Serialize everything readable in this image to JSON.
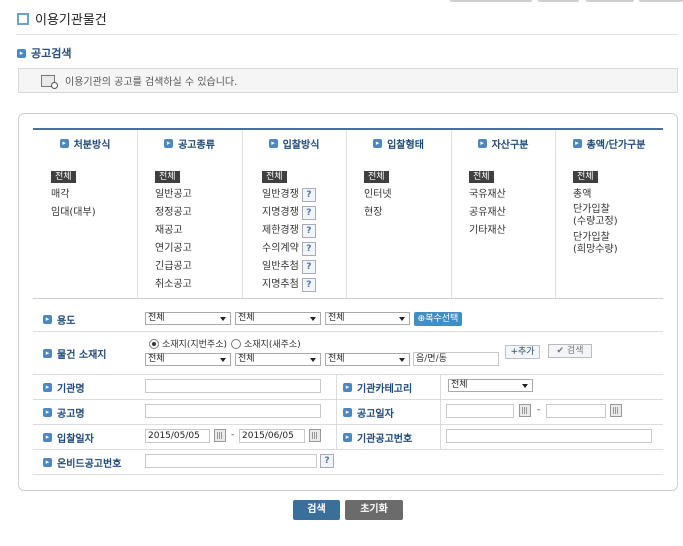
{
  "page_title": "이용기관물건",
  "section_title": "공고검색",
  "info_text": "이용기관의 공고를 검색하실 수 있습니다.",
  "columns": [
    {
      "header": "처분방식",
      "items": [
        {
          "label": "전체",
          "selected": true,
          "help": false
        },
        {
          "label": "매각",
          "selected": false,
          "help": false
        },
        {
          "label": "임대(대부)",
          "selected": false,
          "help": false
        }
      ]
    },
    {
      "header": "공고종류",
      "items": [
        {
          "label": "전체",
          "selected": true,
          "help": false
        },
        {
          "label": "일반공고",
          "selected": false,
          "help": false
        },
        {
          "label": "정정공고",
          "selected": false,
          "help": false
        },
        {
          "label": "재공고",
          "selected": false,
          "help": false
        },
        {
          "label": "연기공고",
          "selected": false,
          "help": false
        },
        {
          "label": "긴급공고",
          "selected": false,
          "help": false
        },
        {
          "label": "취소공고",
          "selected": false,
          "help": false
        }
      ]
    },
    {
      "header": "입찰방식",
      "items": [
        {
          "label": "전체",
          "selected": true,
          "help": false
        },
        {
          "label": "일반경쟁",
          "selected": false,
          "help": true
        },
        {
          "label": "지명경쟁",
          "selected": false,
          "help": true
        },
        {
          "label": "제한경쟁",
          "selected": false,
          "help": true
        },
        {
          "label": "수의계약",
          "selected": false,
          "help": true
        },
        {
          "label": "일반추첨",
          "selected": false,
          "help": true
        },
        {
          "label": "지명추첨",
          "selected": false,
          "help": true
        }
      ]
    },
    {
      "header": "입찰형태",
      "items": [
        {
          "label": "전체",
          "selected": true,
          "help": false
        },
        {
          "label": "인터넷",
          "selected": false,
          "help": false
        },
        {
          "label": "현장",
          "selected": false,
          "help": false
        }
      ]
    },
    {
      "header": "자산구분",
      "items": [
        {
          "label": "전체",
          "selected": true,
          "help": false
        },
        {
          "label": "국유재산",
          "selected": false,
          "help": false
        },
        {
          "label": "공유재산",
          "selected": false,
          "help": false
        },
        {
          "label": "기타재산",
          "selected": false,
          "help": false
        }
      ]
    },
    {
      "header": "총액/단가구분",
      "items": [
        {
          "label": "전체",
          "selected": true,
          "help": false
        },
        {
          "label": "총액",
          "selected": false,
          "help": false
        },
        {
          "label": "단가입찰\n(수량고정)",
          "selected": false,
          "help": false
        },
        {
          "label": "단가입찰\n(희망수량)",
          "selected": false,
          "help": false
        }
      ]
    }
  ],
  "help_mark": "?",
  "usage": {
    "label": "용도",
    "selects": [
      "전체",
      "전체",
      "전체"
    ],
    "multi_button": "복수선택"
  },
  "location": {
    "label": "물건 소재지",
    "radio1": "소재지(지번주소)",
    "radio2": "소재지(새주소)",
    "selects": [
      "전체",
      "전체",
      "전체"
    ],
    "dong_placeholder": "읍/면/동",
    "add_button": "+추가",
    "search_button": "검색"
  },
  "org_name": {
    "label": "기관명",
    "value": ""
  },
  "org_category": {
    "label": "기관카테고리",
    "value": "전체"
  },
  "notice_name": {
    "label": "공고명",
    "value": ""
  },
  "notice_date": {
    "label": "공고일자",
    "from": "",
    "to": "",
    "separator": "-"
  },
  "bid_date": {
    "label": "입찰일자",
    "from": "2015/05/05",
    "to": "2015/06/05",
    "separator": "-"
  },
  "org_notice_no": {
    "label": "기관공고번호",
    "value": ""
  },
  "onbid_notice_no": {
    "label": "온비드공고번호",
    "value": ""
  },
  "buttons": {
    "search": "검색",
    "reset": "초기화"
  },
  "colors": {
    "accent": "#1f4a7a",
    "search_btn": "#3a6f9c",
    "reset_btn": "#6b6b6b"
  }
}
